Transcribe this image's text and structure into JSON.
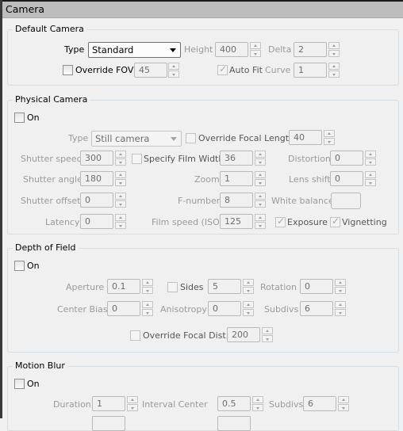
{
  "rollout": {
    "title": "Camera"
  },
  "default_camera": {
    "title": "Default Camera",
    "type_label": "Type",
    "type_value": "Standard",
    "height_label": "Height",
    "height_value": "400",
    "delta_label": "Delta",
    "delta_value": "2",
    "override_fov_label": "Override FOV",
    "override_fov_checked": false,
    "fov_value": "45",
    "auto_fit_label": "Auto Fit",
    "auto_fit_checked": true,
    "curve_label": "Curve",
    "curve_value": "1"
  },
  "physical_camera": {
    "title": "Physical Camera",
    "on_label": "On",
    "on_checked": false,
    "type_label": "Type",
    "type_value": "Still camera",
    "override_focal_length_label": "Override Focal Length",
    "focal_length_value": "40",
    "shutter_speed_label": "Shutter speed",
    "shutter_speed_value": "300",
    "specify_film_width_label": "Specify Film Width",
    "film_width_value": "36",
    "distortion_label": "Distortion",
    "distortion_value": "0",
    "shutter_angle_label": "Shutter angle",
    "shutter_angle_value": "180",
    "zoom_label": "Zoom",
    "zoom_value": "1",
    "lens_shift_label": "Lens shift",
    "lens_shift_value": "0",
    "shutter_offset_label": "Shutter offset",
    "shutter_offset_value": "0",
    "f_number_label": "F-number",
    "f_number_value": "8",
    "white_balance_label": "White balance",
    "latency_label": "Latency",
    "latency_value": "0",
    "film_speed_label": "Film speed (ISO)",
    "film_speed_value": "125",
    "exposure_label": "Exposure",
    "exposure_checked": true,
    "vignetting_label": "Vignetting",
    "vignetting_checked": true
  },
  "depth_of_field": {
    "title": "Depth of Field",
    "on_label": "On",
    "on_checked": false,
    "aperture_label": "Aperture",
    "aperture_value": "0.1",
    "sides_label": "Sides",
    "sides_value": "5",
    "rotation_label": "Rotation",
    "rotation_value": "0",
    "center_bias_label": "Center Bias",
    "center_bias_value": "0",
    "anisotropy_label": "Anisotropy",
    "anisotropy_value": "0",
    "subdivs_label": "Subdivs",
    "subdivs_value": "6",
    "override_focal_dist_label": "Override Focal Dist.",
    "focal_dist_value": "200"
  },
  "motion_blur": {
    "title": "Motion Blur",
    "on_label": "On",
    "on_checked": false,
    "duration_label": "Duration",
    "duration_value": "1",
    "interval_center_label": "Interval Center",
    "interval_center_value": "0.5",
    "subdivs_label": "Subdivs",
    "subdivs_value": "6"
  }
}
